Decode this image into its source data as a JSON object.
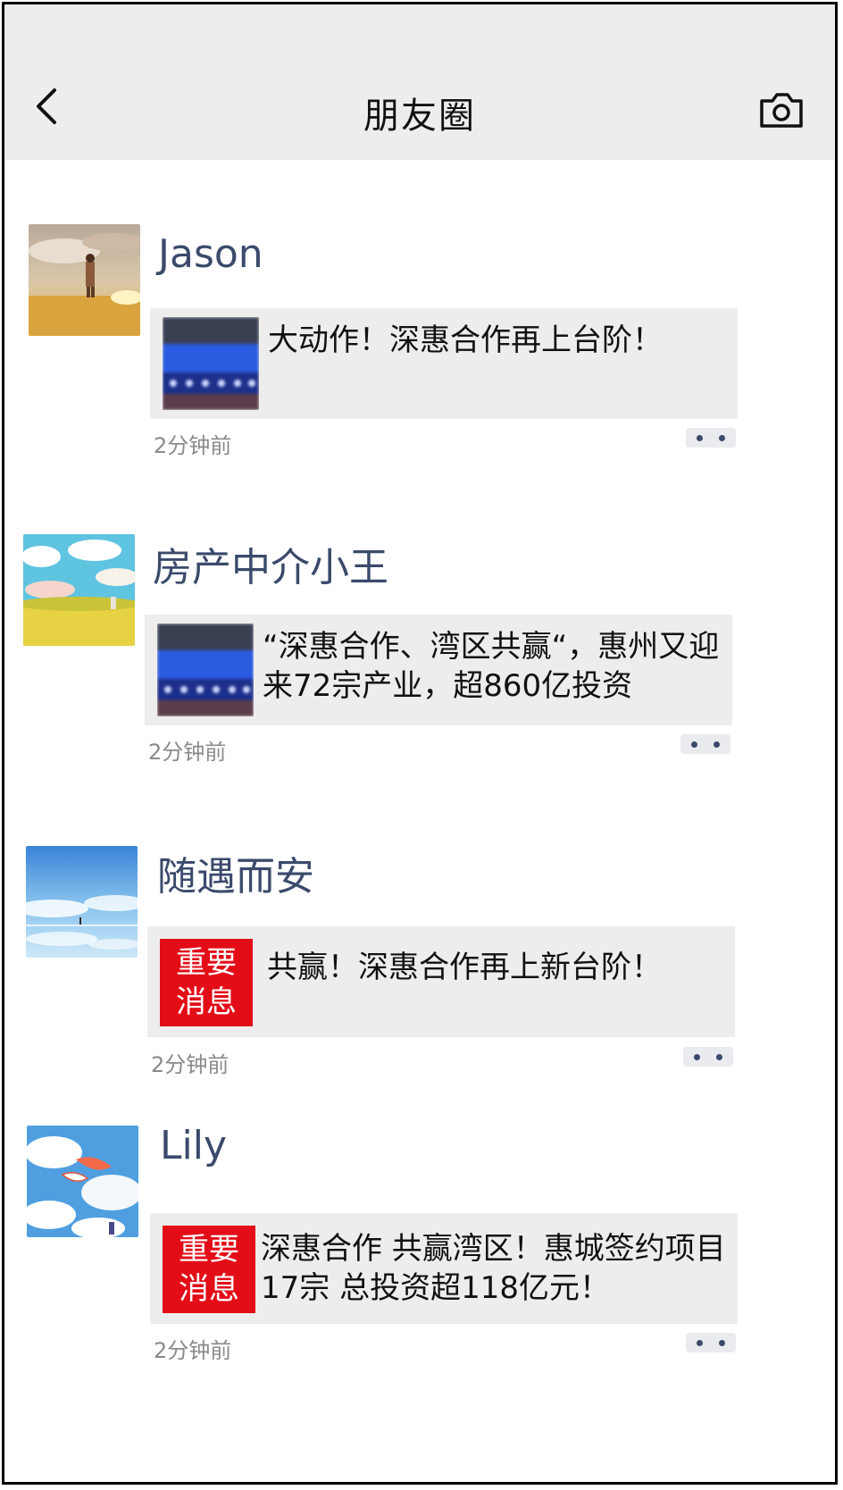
{
  "header": {
    "title": "朋友圈",
    "back_icon": "chevron-left-icon",
    "camera_icon": "camera-icon"
  },
  "posts": [
    {
      "username": "Jason",
      "avatar": "avatar-girl-in-golden-field",
      "card": {
        "type": "thumbnail",
        "text": "大动作！深惠合作再上台阶！"
      },
      "time": "2分钟前"
    },
    {
      "username": "房产中介小王",
      "avatar": "avatar-sunny-meadow",
      "card": {
        "type": "thumbnail",
        "text": "“深惠合作、湾区共赢“，惠州又迎来72宗产业，超860亿投资"
      },
      "time": "2分钟前"
    },
    {
      "username": "随遇而安",
      "avatar": "avatar-sky-reflection",
      "card": {
        "type": "badge",
        "badge_line1": "重要",
        "badge_line2": "消息",
        "text": "共赢！深惠合作再上新台阶！"
      },
      "time": "2分钟前"
    },
    {
      "username": "Lily",
      "avatar": "avatar-koi-in-clouds",
      "card": {
        "type": "badge",
        "badge_line1": "重要",
        "badge_line2": "消息",
        "text": "深惠合作 共赢湾区！惠城签约项目17宗 总投资超118亿元！"
      },
      "time": "2分钟前"
    }
  ],
  "colors": {
    "header_bg": "#ededed",
    "name": "#3b4a6b",
    "badge": "#e30d18",
    "card_bg": "#ededed",
    "time": "#8a8a8a"
  }
}
